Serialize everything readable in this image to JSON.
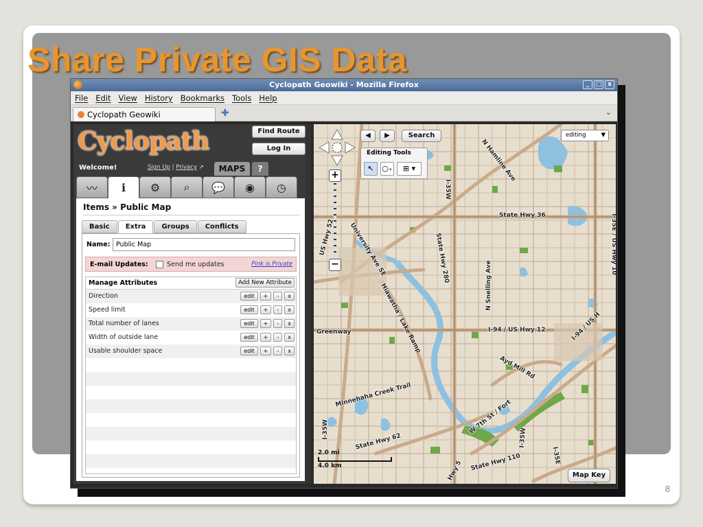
{
  "slide": {
    "title": "Share Private GIS Data",
    "page_number": "8"
  },
  "window": {
    "title": "Cyclopath Geowiki - Mozilla Firefox",
    "controls": [
      "_",
      "□",
      "x"
    ]
  },
  "menu": [
    "File",
    "Edit",
    "View",
    "History",
    "Bookmarks",
    "Tools",
    "Help"
  ],
  "browser_tab": {
    "label": "Cyclopath Geowiki",
    "new_tab": "✚",
    "list_arrow": "⌄"
  },
  "app": {
    "logo": "Cyclopath",
    "find_route": "Find Route",
    "log_in": "Log In",
    "welcome": "Welcome!",
    "sign_up": "Sign Up",
    "separator": "|",
    "privacy": "Privacy",
    "privacy_icon": "↗",
    "maps_tab": "MAPS",
    "help_tab": "?",
    "icon_tabs": [
      {
        "name": "routes-icon",
        "glyph": "〰"
      },
      {
        "name": "info-icon",
        "glyph": "ℹ"
      },
      {
        "name": "settings-icon",
        "glyph": "⚙"
      },
      {
        "name": "search-icon",
        "glyph": "⌕"
      },
      {
        "name": "discussions-icon",
        "glyph": "💬"
      },
      {
        "name": "view-icon",
        "glyph": "◉"
      },
      {
        "name": "history-icon",
        "glyph": "◷"
      }
    ],
    "breadcrumb": "Items » Public Map",
    "sub_tabs": [
      "Basic",
      "Extra",
      "Groups",
      "Conflicts"
    ],
    "active_sub_tab": "Extra",
    "name_label": "Name:",
    "name_value": "Public Map",
    "email_label": "E-mail Updates:",
    "send_label": "Send me updates",
    "pink_link": "Pink is Private",
    "manage_title": "Manage Attributes",
    "add_attr": "Add New Attribute",
    "attributes": [
      "Direction",
      "Speed limit",
      "Total number of lanes",
      "Width of outside lane",
      "Usable shoulder space"
    ],
    "row_buttons": [
      "edit",
      "+",
      "-",
      "x"
    ]
  },
  "map": {
    "search": "Search",
    "back": "◀",
    "forward": "▶",
    "editing_tools": "Editing Tools",
    "editing_dropdown": "editing",
    "dropdown_arrow": "▼",
    "tools": [
      "↖",
      "○₊",
      "⊞",
      "▾"
    ],
    "zoom_in": "+",
    "zoom_out": "−",
    "scale_mi": "2.0 mi",
    "scale_km": "4.0 km",
    "map_key": "Map Key",
    "labels": [
      {
        "text": "N Hamline Ave",
        "rot": 52
      },
      {
        "text": "State Hwy 36",
        "rot": 0
      },
      {
        "text": "I-35E / US Hwy 10",
        "rot": 90
      },
      {
        "text": "I-35W",
        "rot": 90
      },
      {
        "text": "US Hwy 52",
        "rot": -75
      },
      {
        "text": "University Ave SE",
        "rot": 58
      },
      {
        "text": "State Hwy 280",
        "rot": 80
      },
      {
        "text": "N Snelling Ave",
        "rot": -90
      },
      {
        "text": "I-94 / US Hwy 12",
        "rot": 0
      },
      {
        "text": "I-94 / US H",
        "rot": -45
      },
      {
        "text": "Hiawatha / Lake Ramp",
        "rot": 62
      },
      {
        "text": "Greenway",
        "rot": 0
      },
      {
        "text": "I-35W",
        "rot": -90
      },
      {
        "text": "I-94",
        "rot": -80
      },
      {
        "text": "Ayd Mill Rd",
        "rot": 30
      },
      {
        "text": "Minnehaha Creek Trail",
        "rot": -15
      },
      {
        "text": "W 7th St / Fort",
        "rot": -38
      },
      {
        "text": "State Hwy 62",
        "rot": -15
      },
      {
        "text": "I-35W",
        "rot": -85
      },
      {
        "text": "I-35E",
        "rot": 80
      },
      {
        "text": "State Hwy 110",
        "rot": -15
      },
      {
        "text": "Hwy 5",
        "rot": -62
      }
    ]
  }
}
